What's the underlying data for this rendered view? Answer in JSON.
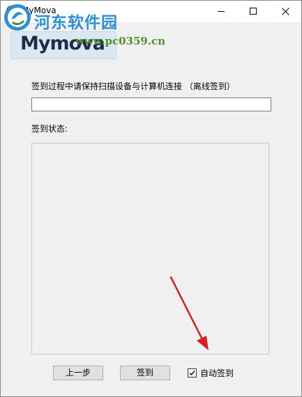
{
  "window": {
    "title": "MyMova"
  },
  "watermark": {
    "site_name": "河东软件园",
    "url": "www.pc0359.cn"
  },
  "logo": {
    "wordmark": "Mymova"
  },
  "main": {
    "instruction": "签到过程中请保持扫描设备与计算机连接 （离线签到）",
    "path_value": "",
    "status_label": "签到状态:"
  },
  "footer": {
    "prev_button": "上一步",
    "sign_button": "签到",
    "auto_checkbox_label": "自动签到",
    "auto_checked": true
  },
  "colors": {
    "window_bg": "#f0f0f0",
    "annotation_arrow": "#d42020",
    "watermark_blue": "#2d8fd6",
    "watermark_green": "#4f8f2f"
  },
  "icons": [
    "app-icon",
    "minimize-icon",
    "maximize-icon",
    "close-icon",
    "checkmark-icon",
    "annotation-arrow"
  ]
}
